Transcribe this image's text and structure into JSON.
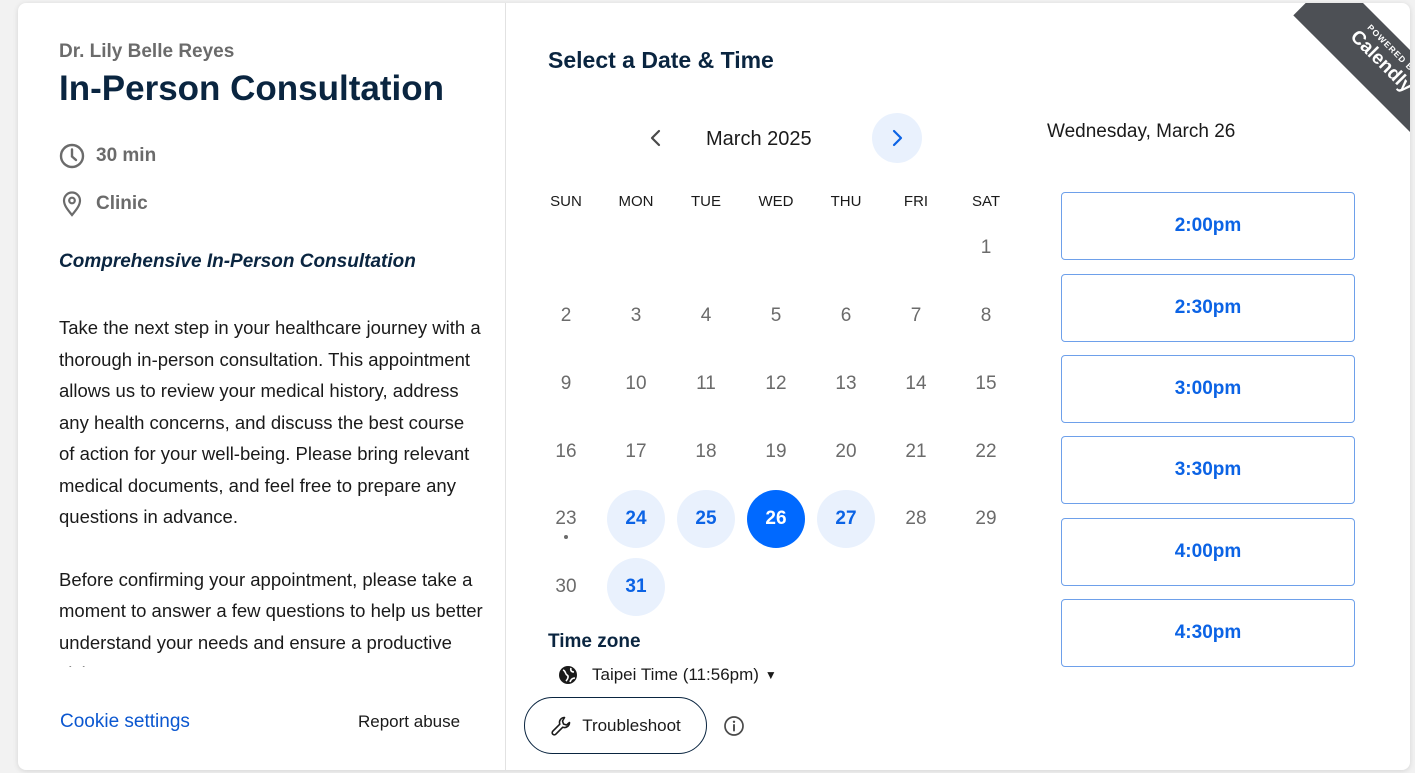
{
  "event": {
    "host": "Dr. Lily Belle Reyes",
    "title": "In-Person Consultation",
    "duration": "30 min",
    "location": "Clinic",
    "description_heading": "Comprehensive In-Person Consultation",
    "description_p1": "Take the next step in your healthcare journey with a thorough in-person consultation. This appointment allows us to review your medical history, address any health concerns, and discuss the best course of action for your well-being. Please bring relevant medical documents, and feel free to prepare any questions in advance.",
    "description_p2": "Before confirming your appointment, please take a moment to answer a few questions to help us better understand your needs and ensure a productive visit."
  },
  "footer": {
    "cookie_settings": "Cookie settings",
    "report_abuse": "Report abuse"
  },
  "calendar": {
    "heading": "Select a Date & Time",
    "month_label": "March 2025",
    "weekdays": [
      "SUN",
      "MON",
      "TUE",
      "WED",
      "THU",
      "FRI",
      "SAT"
    ],
    "days": [
      "1",
      "2",
      "3",
      "4",
      "5",
      "6",
      "7",
      "8",
      "9",
      "10",
      "11",
      "12",
      "13",
      "14",
      "15",
      "16",
      "17",
      "18",
      "19",
      "20",
      "21",
      "22",
      "23",
      "24",
      "25",
      "26",
      "27",
      "28",
      "29",
      "30",
      "31"
    ],
    "available_days": [
      24,
      25,
      26,
      27,
      31
    ],
    "selected_day": 26,
    "today_marker_day": 23
  },
  "timezone": {
    "label": "Time zone",
    "value": "Taipei Time (11:56pm)"
  },
  "troubleshoot": {
    "label": "Troubleshoot"
  },
  "slots": {
    "date_heading": "Wednesday, March 26",
    "times": [
      "2:00pm",
      "2:30pm",
      "3:00pm",
      "3:30pm",
      "4:00pm",
      "4:30pm"
    ]
  },
  "badge": {
    "powered_by": "POWERED BY",
    "brand": "Calendly"
  },
  "colors": {
    "accent": "#0069ff",
    "available_bg": "#e9f1fd",
    "slot_border": "#6ea0ea",
    "ribbon": "#4d5055"
  }
}
